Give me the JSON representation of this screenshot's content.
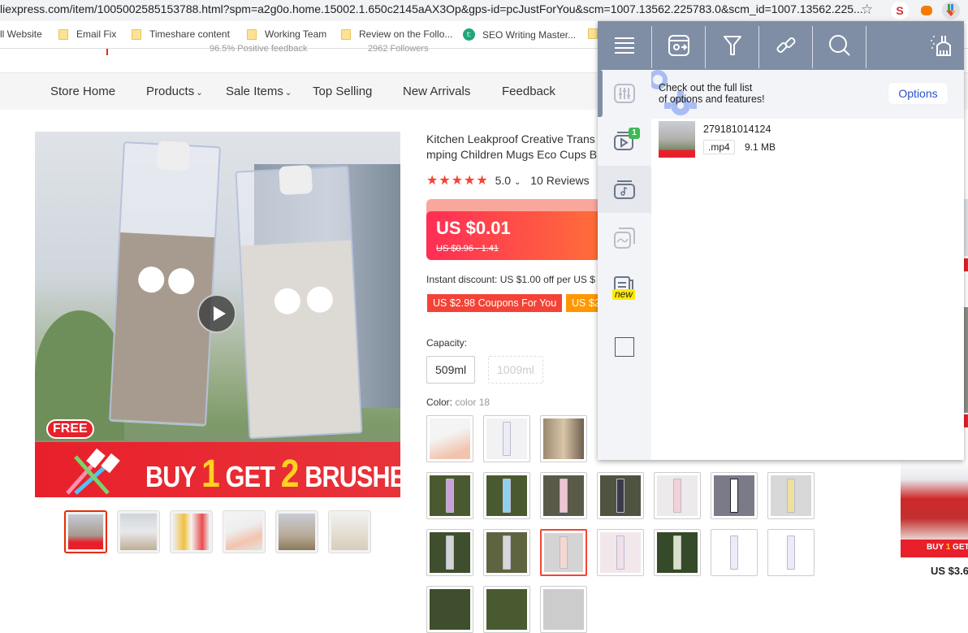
{
  "browser": {
    "url": "liexpress.com/item/1005002585153788.html?spm=a2g0o.home.15002.1.650c2145aAX3Op&gps-id=pcJustForYou&scm=1007.13562.225783.0&scm_id=1007.13562.225...",
    "bookmarks": [
      {
        "label": "ll Website",
        "icon": "none"
      },
      {
        "label": "Email Fix",
        "icon": "folder-icon"
      },
      {
        "label": "Timeshare content",
        "icon": "folder-icon"
      },
      {
        "label": "Working Team",
        "icon": "folder-icon"
      },
      {
        "label": "Review on the Follo...",
        "icon": "folder-icon"
      },
      {
        "label": "SEO Writing Master...",
        "icon": "t-badge"
      }
    ],
    "extensions": [
      {
        "name": "seo-extension",
        "label": "SEO"
      },
      {
        "name": "robot-extension",
        "label": ""
      },
      {
        "name": "downloader-extension",
        "label": ""
      }
    ]
  },
  "store": {
    "positive_feedback": "96.5% Positive feedback",
    "followers": "2962 Followers",
    "nav": [
      "Store Home",
      "Products",
      "Sale Items",
      "Top Selling",
      "New Arrivals",
      "Feedback"
    ]
  },
  "product": {
    "title_line1": "Kitchen Leakproof Creative Trans",
    "title_line2": "mping Children Mugs Eco Cups B",
    "rating": "5.0",
    "reviews": "10 Reviews",
    "price": "US $0.01",
    "original_price": "US $0.96 - 1.41",
    "discount_text": "Instant discount: US $1.00 off per US $",
    "coupons": [
      "US $2.98 Coupons For You",
      "US $2"
    ],
    "banner": {
      "free": "FREE",
      "buy": "BUY",
      "one": "1",
      "get": "GET",
      "two": "2",
      "brushes": "BRUSHES"
    },
    "capacity_label": "Capacity:",
    "capacity_options": [
      {
        "label": "509ml",
        "available": true
      },
      {
        "label": "1009ml",
        "available": false
      }
    ],
    "color_label": "Color:",
    "color_value": "color 18",
    "thumbnail_count": 6
  },
  "related": {
    "price": "US $3.6"
  },
  "extension_popup": {
    "toolbar": [
      "menu-icon",
      "settings-export-icon",
      "filter-icon",
      "link-icon",
      "search-icon",
      "clean-icon"
    ],
    "sidebar": [
      {
        "name": "equalizer-icon",
        "badge": ""
      },
      {
        "name": "video-icon",
        "badge": "1"
      },
      {
        "name": "music-icon",
        "badge": ""
      },
      {
        "name": "images-icon",
        "badge": ""
      },
      {
        "name": "document-icon",
        "badge": "new"
      },
      {
        "name": "checkbox-icon",
        "badge": ""
      }
    ],
    "promo_line1": "Check out the full list",
    "promo_line2": "of options and features!",
    "options_button": "Options",
    "media": {
      "name": "279181014124",
      "extension": ".mp4",
      "size": "9.1 MB"
    }
  }
}
